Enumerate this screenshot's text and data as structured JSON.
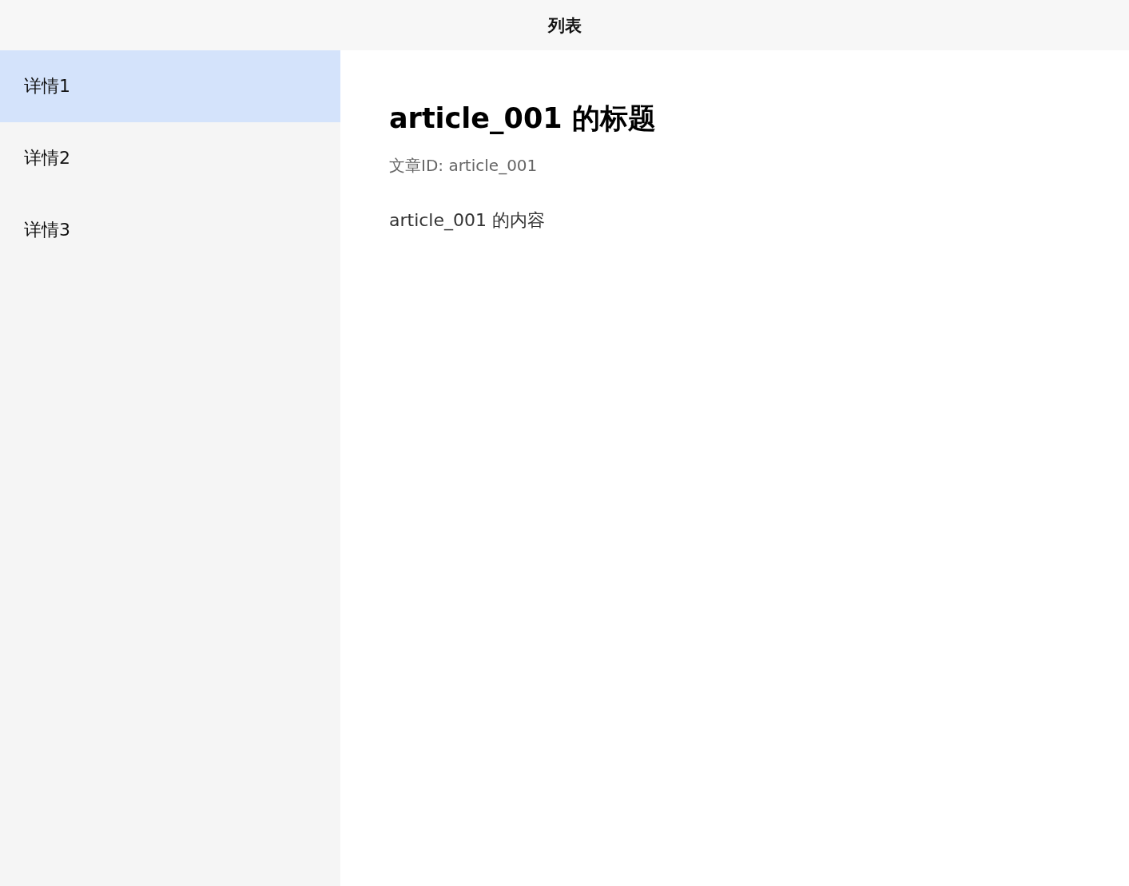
{
  "header": {
    "title": "列表"
  },
  "sidebar": {
    "items": [
      {
        "label": "详情1",
        "selected": true
      },
      {
        "label": "详情2",
        "selected": false
      },
      {
        "label": "详情3",
        "selected": false
      }
    ]
  },
  "article": {
    "title": "article_001 的标题",
    "meta": "文章ID: article_001",
    "body": "article_001 的内容"
  }
}
